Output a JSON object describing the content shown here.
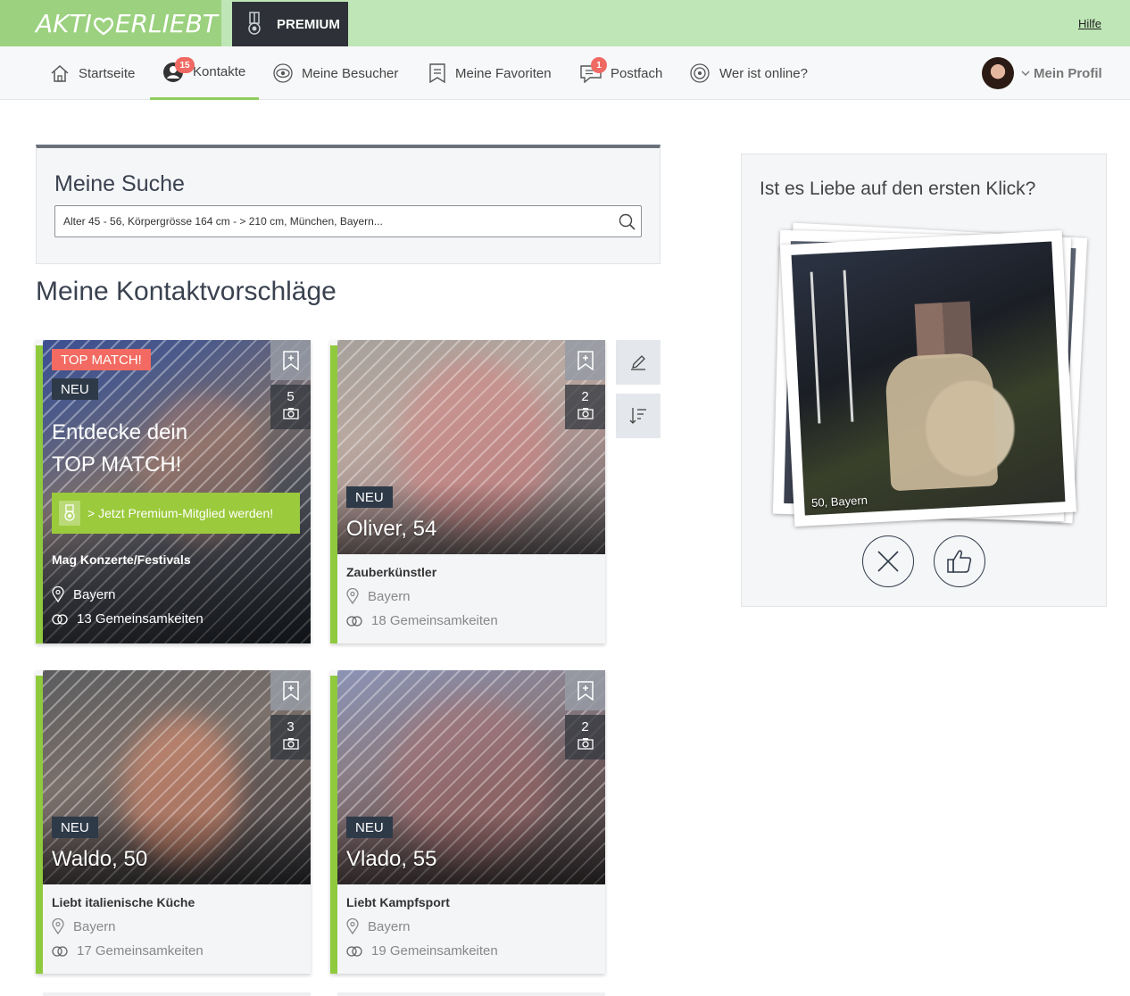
{
  "header": {
    "logo": "AKTIV VERLIEBT",
    "premium_label": "PREMIUM",
    "help_link": "Hilfe"
  },
  "nav": {
    "items": [
      {
        "label": "Startseite",
        "icon": "home-icon"
      },
      {
        "label": "Kontakte",
        "icon": "user-icon",
        "badge": "15",
        "active": true
      },
      {
        "label": "Meine Besucher",
        "icon": "eye-icon"
      },
      {
        "label": "Meine Favoriten",
        "icon": "bookmark-icon"
      },
      {
        "label": "Postfach",
        "icon": "chat-icon",
        "badge": "1"
      },
      {
        "label": "Wer ist online?",
        "icon": "online-icon"
      }
    ],
    "profile_label": "Mein Profil"
  },
  "search": {
    "title": "Meine Suche",
    "value": "Alter 45 - 56, Körpergrösse 164 cm - > 210 cm, München, Bayern..."
  },
  "suggestions_title": "Meine Kontaktvorschläge",
  "top_match": {
    "label": "TOP MATCH!",
    "neu": "NEU",
    "photo_count": "5",
    "headline_line1": "Entdecke dein",
    "headline_line2": "TOP MATCH!",
    "cta": "> Jetzt Premium-Mitglied werden!",
    "tagline": "Mag Konzerte/Festivals",
    "location": "Bayern",
    "commonalities": "13 Gemeinsamkeiten"
  },
  "cards": [
    {
      "name": "Oliver, 54",
      "neu": "NEU",
      "photo_count": "2",
      "tagline": "Zauberkünstler",
      "location": "Bayern",
      "commonalities": "18 Gemeinsamkeiten"
    },
    {
      "name": "Waldo, 50",
      "neu": "NEU",
      "photo_count": "3",
      "tagline": "Liebt italienische Küche",
      "location": "Bayern",
      "commonalities": "17 Gemeinsamkeiten"
    },
    {
      "name": "Vlado, 55",
      "neu": "NEU",
      "photo_count": "2",
      "tagline": "Liebt Kampfsport",
      "location": "Bayern",
      "commonalities": "19 Gemeinsamkeiten"
    }
  ],
  "klick": {
    "title": "Ist es Liebe auf den ersten Klick?",
    "caption": "50, Bayern"
  },
  "colors": {
    "accent_green": "#8fca3e",
    "badge_red": "#f06a64",
    "top_match_red": "#f26a61",
    "dark_navy": "#2e3a48"
  }
}
